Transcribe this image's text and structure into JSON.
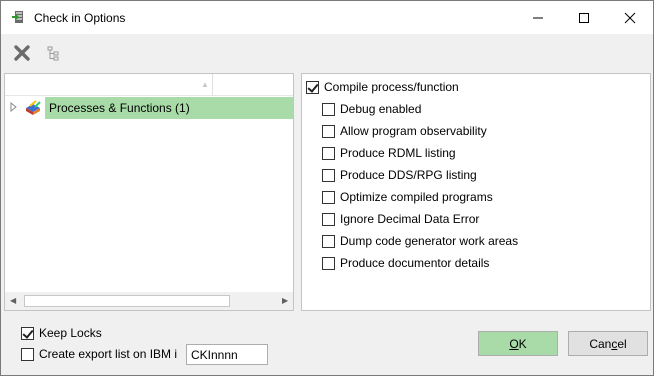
{
  "window": {
    "title": "Check in Options"
  },
  "tree": {
    "items": [
      {
        "label": "Processes & Functions (1)",
        "selected": true
      }
    ]
  },
  "options": {
    "compile": {
      "label": "Compile process/function",
      "checked": true
    },
    "sub_options": [
      {
        "label": "Debug enabled",
        "checked": false
      },
      {
        "label": "Allow program observability",
        "checked": false
      },
      {
        "label": "Produce RDML listing",
        "checked": false
      },
      {
        "label": "Produce DDS/RPG listing",
        "checked": false
      },
      {
        "label": "Optimize compiled programs",
        "checked": false
      },
      {
        "label": "Ignore Decimal Data Error",
        "checked": false
      },
      {
        "label": "Dump code generator work areas",
        "checked": false
      },
      {
        "label": "Produce documentor details",
        "checked": false
      }
    ]
  },
  "footer": {
    "keep_locks": {
      "label": "Keep Locks",
      "checked": true
    },
    "export_list": {
      "label": "Create export list on IBM i",
      "checked": false
    },
    "export_list_value": "CKInnnn",
    "ok_label_first": "O",
    "ok_label_rest": "K",
    "cancel_label_first": "Can",
    "cancel_label_mid": "c",
    "cancel_label_rest": "el"
  },
  "colors": {
    "selection": "#a8dba8",
    "primary_button": "#a8dba8"
  }
}
